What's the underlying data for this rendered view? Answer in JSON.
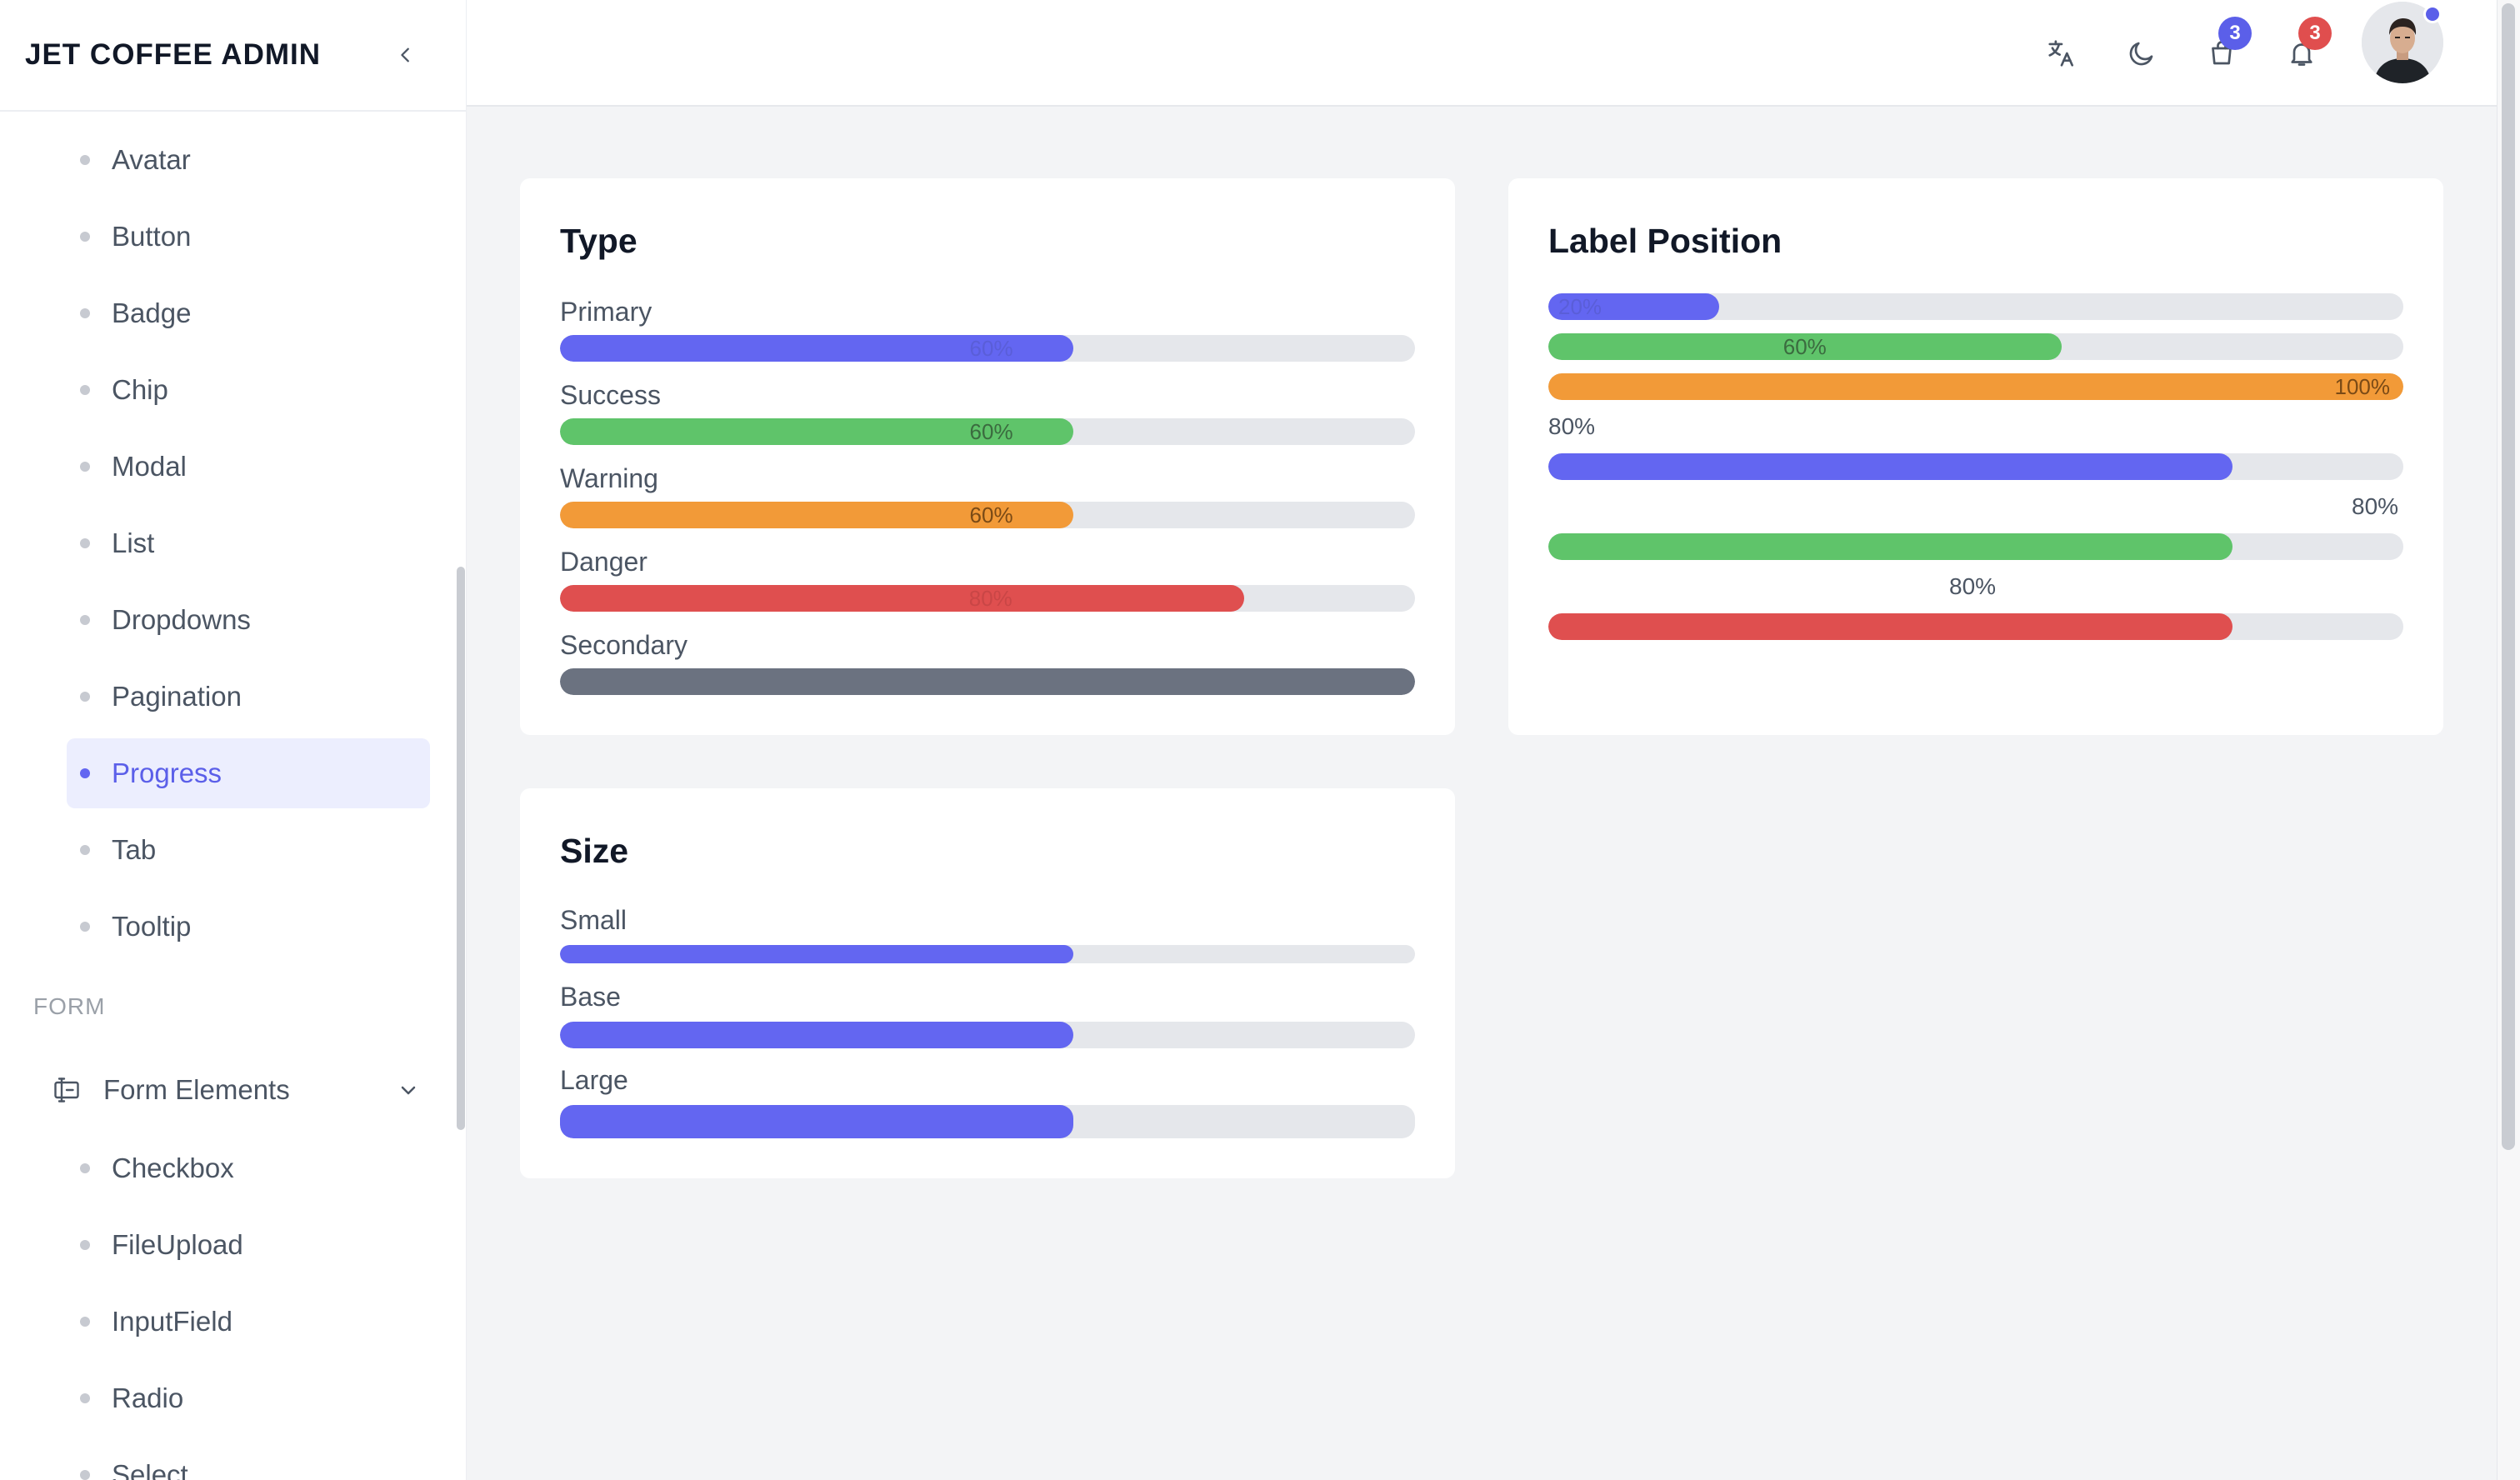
{
  "app": {
    "title": "JET COFFEE ADMIN"
  },
  "sidebar": {
    "items": [
      {
        "label": "Avatar"
      },
      {
        "label": "Button"
      },
      {
        "label": "Badge"
      },
      {
        "label": "Chip"
      },
      {
        "label": "Modal"
      },
      {
        "label": "List"
      },
      {
        "label": "Dropdowns"
      },
      {
        "label": "Pagination"
      },
      {
        "label": "Progress",
        "active": true
      },
      {
        "label": "Tab"
      },
      {
        "label": "Tooltip"
      }
    ],
    "section_form": "FORM",
    "form_group": {
      "label": "Form Elements",
      "icon": "form-elements-icon"
    },
    "form_items": [
      {
        "label": "Checkbox"
      },
      {
        "label": "FileUpload"
      },
      {
        "label": "InputField"
      },
      {
        "label": "Radio"
      },
      {
        "label": "Select"
      }
    ]
  },
  "topbar": {
    "icons": [
      "translate-icon",
      "moon-icon",
      "shopping-bag-icon",
      "bell-icon"
    ],
    "cart_badge": "3",
    "notification_badge": "3",
    "colors": {
      "cart_badge": "#5b5fe9",
      "notification_badge": "#e04e4e",
      "avatar_status": "#5b5fe9"
    }
  },
  "colors": {
    "primary": "#6366f1",
    "success": "#5fc46a",
    "warning": "#f29a38",
    "danger": "#df4f4f",
    "secondary": "#6b7280",
    "track": "#e5e7eb"
  },
  "type_card": {
    "title": "Type",
    "bars": [
      {
        "label": "Primary",
        "percent": 60,
        "text": "60%",
        "color": "primary"
      },
      {
        "label": "Success",
        "percent": 60,
        "text": "60%",
        "color": "success"
      },
      {
        "label": "Warning",
        "percent": 60,
        "text": "60%",
        "color": "warning"
      },
      {
        "label": "Danger",
        "percent": 80,
        "text": "80%",
        "color": "danger"
      },
      {
        "label": "Secondary",
        "percent": 100,
        "text": "",
        "color": "secondary"
      }
    ]
  },
  "label_card": {
    "title": "Label Position",
    "bars": [
      {
        "percent": 20,
        "text": "20%",
        "position": "inside",
        "color": "primary"
      },
      {
        "percent": 60,
        "text": "60%",
        "position": "inside-center",
        "color": "success"
      },
      {
        "percent": 100,
        "text": "100%",
        "position": "inside-end",
        "color": "warning"
      },
      {
        "percent": 80,
        "text": "80%",
        "position": "top-left",
        "color": "primary"
      },
      {
        "percent": 80,
        "text": "80%",
        "position": "top-right",
        "color": "success"
      },
      {
        "percent": 80,
        "text": "80%",
        "position": "top-center",
        "color": "danger"
      }
    ]
  },
  "size_card": {
    "title": "Size",
    "bars": [
      {
        "label": "Small",
        "percent": 60,
        "color": "primary"
      },
      {
        "label": "Base",
        "percent": 60,
        "color": "primary"
      },
      {
        "label": "Large",
        "percent": 60,
        "color": "primary"
      }
    ]
  }
}
